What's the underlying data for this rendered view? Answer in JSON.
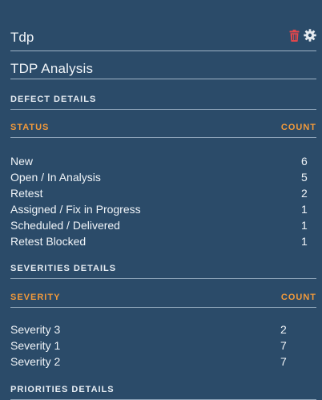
{
  "widget": {
    "title": "Tdp",
    "delete_icon": "trash-icon",
    "settings_icon": "gear-icon",
    "delete_color": "#e0474c"
  },
  "analysis": {
    "title": "TDP Analysis"
  },
  "defect_details": {
    "section_title": "DEFECT DETAILS",
    "col_left": "STATUS",
    "col_right": "COUNT",
    "rows": [
      {
        "label": "New",
        "count": "6"
      },
      {
        "label": "Open / In Analysis",
        "count": "5"
      },
      {
        "label": "Retest",
        "count": "2"
      },
      {
        "label": "Assigned / Fix in Progress",
        "count": "1"
      },
      {
        "label": "Scheduled / Delivered",
        "count": "1"
      },
      {
        "label": "Retest Blocked",
        "count": "1"
      }
    ]
  },
  "severities_details": {
    "section_title": "SEVERITIES DETAILS",
    "col_left": "SEVERITY",
    "col_right": "COUNT",
    "rows": [
      {
        "label": "Severity 3",
        "count": "2"
      },
      {
        "label": "Severity 1",
        "count": "7"
      },
      {
        "label": "Severity 2",
        "count": "7"
      }
    ]
  },
  "priorities_details": {
    "section_title": "PRIORITIES DETAILS"
  },
  "colors": {
    "background": "#2b4b69",
    "accent": "#f39a3a",
    "divider": "#8ea4b9"
  }
}
